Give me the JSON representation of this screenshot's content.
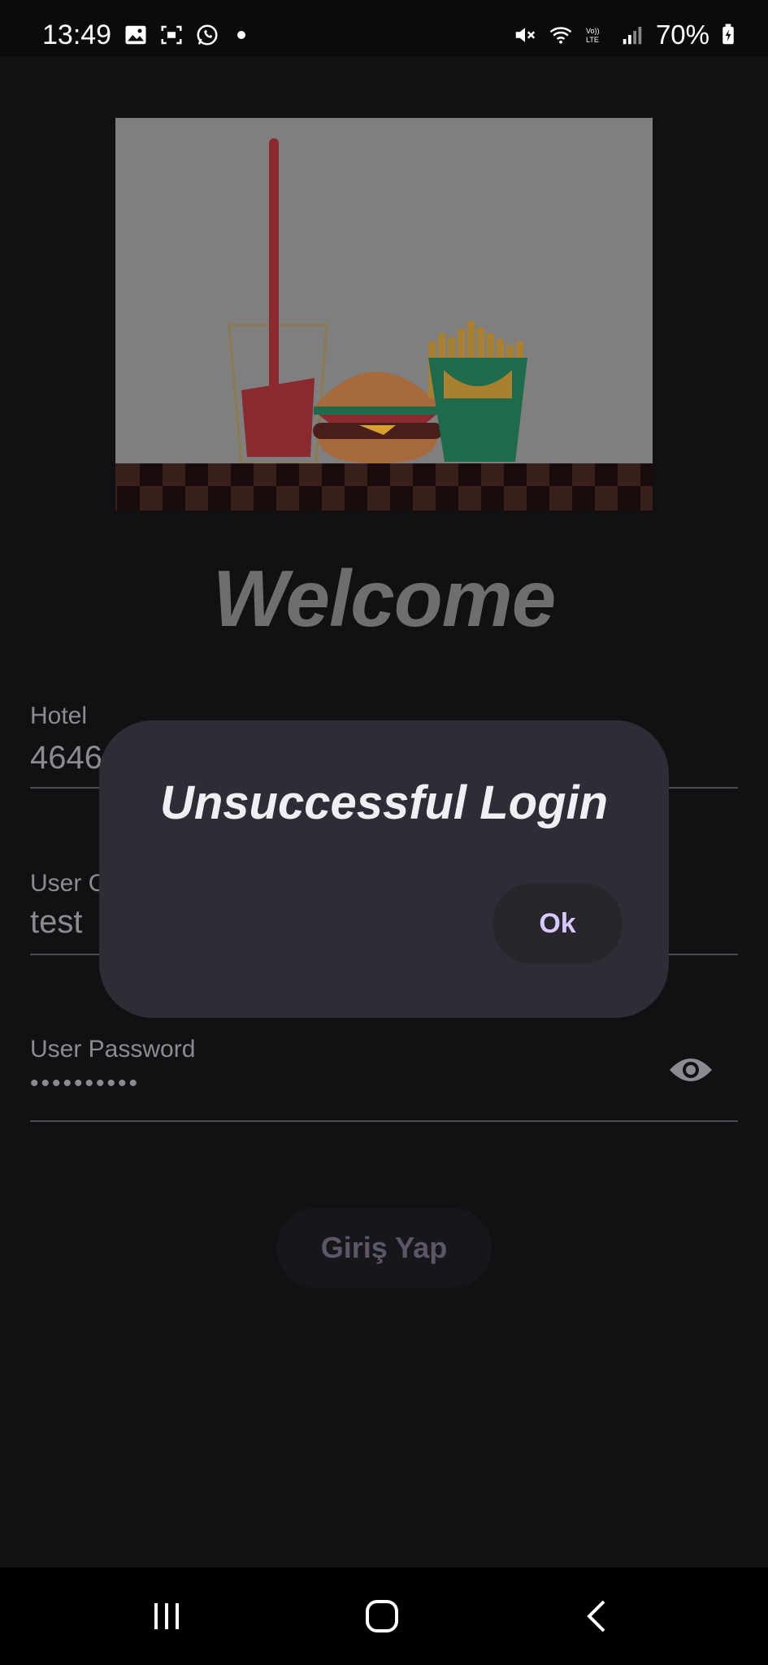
{
  "status_bar": {
    "time": "13:49",
    "battery": "70%",
    "icons": [
      "gallery-icon",
      "screenshot-icon",
      "whatsapp-icon",
      "notification-dot",
      "mute-icon",
      "wifi-icon",
      "volte-icon",
      "signal-icon",
      "battery-icon"
    ]
  },
  "login": {
    "welcome": "Welcome",
    "hotel_label": "Hotel",
    "hotel_value": "4646",
    "user_label": "User C",
    "user_value": "test",
    "password_label": "User Password",
    "password_value": "••••••••••",
    "login_button": "Giriş Yap"
  },
  "dialog": {
    "title": "Unsuccessful Login",
    "ok_label": "Ok"
  },
  "navigation": {
    "recent_icon": "recent-apps-icon",
    "home_icon": "home-icon",
    "back_icon": "back-icon"
  },
  "colors": {
    "background": "#111114",
    "dialog": "#302c36",
    "accent": "#d9c7ff"
  }
}
